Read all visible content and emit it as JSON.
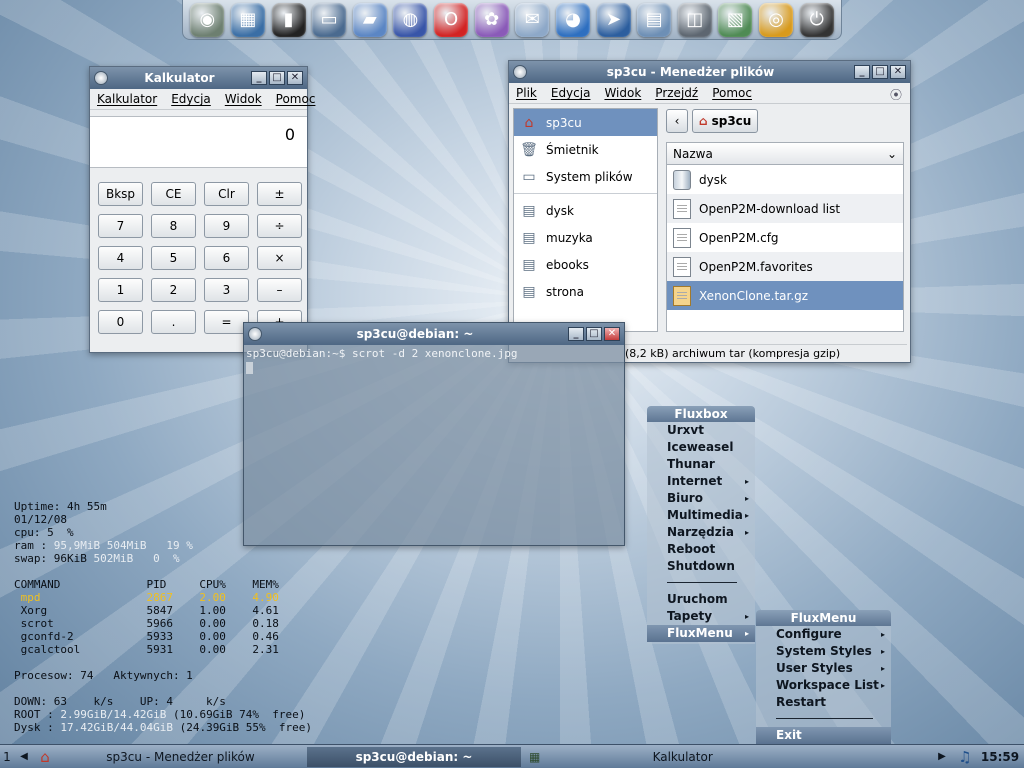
{
  "dock": {
    "icons": [
      {
        "name": "fluxbox-logo-icon",
        "glyph": "◉",
        "color": "#6d7f70"
      },
      {
        "name": "desktop-icon",
        "glyph": "▦",
        "color": "#3a6ea5"
      },
      {
        "name": "terminal-icon",
        "glyph": "▮",
        "color": "#222222"
      },
      {
        "name": "laptop-icon",
        "glyph": "▭",
        "color": "#4a6a8f"
      },
      {
        "name": "folder-icon",
        "glyph": "▰",
        "color": "#5b86c4"
      },
      {
        "name": "network-globe-icon",
        "glyph": "◍",
        "color": "#3855a8"
      },
      {
        "name": "opera-browser-icon",
        "glyph": "O",
        "color": "#d22323"
      },
      {
        "name": "pidgin-messenger-icon",
        "glyph": "✿",
        "color": "#8a5ab8"
      },
      {
        "name": "email-icon",
        "glyph": "✉",
        "color": "#8da8c8"
      },
      {
        "name": "web-browser-icon",
        "glyph": "◕",
        "color": "#2e6fc0"
      },
      {
        "name": "fish-icon",
        "glyph": "➤",
        "color": "#2c5e9e"
      },
      {
        "name": "office-document-icon",
        "glyph": "▤",
        "color": "#6d8fb5"
      },
      {
        "name": "speaker-icon",
        "glyph": "◫",
        "color": "#5d6670"
      },
      {
        "name": "image-viewer-icon",
        "glyph": "▧",
        "color": "#4f8b54"
      },
      {
        "name": "cd-burner-icon",
        "glyph": "◎",
        "color": "#d89a1c"
      },
      {
        "name": "power-icon",
        "glyph": "⏻",
        "color": "#333333"
      }
    ]
  },
  "calculator": {
    "title": "Kalkulator",
    "menu": [
      "Kalkulator",
      "Edycja",
      "Widok",
      "Pomoc"
    ],
    "display": "0",
    "buttons": [
      "Bksp",
      "CE",
      "Clr",
      "±",
      "7",
      "8",
      "9",
      "÷",
      "4",
      "5",
      "6",
      "×",
      "1",
      "2",
      "3",
      "–",
      "0",
      ".",
      "=",
      "+"
    ]
  },
  "filemanager": {
    "title": "sp3cu - Menedżer plików",
    "menu": [
      "Plik",
      "Edycja",
      "Widok",
      "Przejdź",
      "Pomoc"
    ],
    "sidebar": [
      {
        "label": "sp3cu",
        "icon": "home-icon",
        "selected": true
      },
      {
        "label": "Śmietnik",
        "icon": "trash-icon"
      },
      {
        "label": "System plików",
        "icon": "filesystem-icon"
      },
      {
        "label": "dysk",
        "icon": "drive-icon"
      },
      {
        "label": "muzyka",
        "icon": "drive-icon"
      },
      {
        "label": "ebooks",
        "icon": "drive-icon"
      },
      {
        "label": "strona",
        "icon": "drive-icon"
      }
    ],
    "path_button": "sp3cu",
    "column_header": "Nazwa",
    "files": [
      {
        "name": "dysk",
        "type": "drive"
      },
      {
        "name": "OpenP2M-download list",
        "type": "text"
      },
      {
        "name": "OpenP2M.cfg",
        "type": "text"
      },
      {
        "name": "OpenP2M.favorites",
        "type": "text"
      },
      {
        "name": "XenonClone.tar.gz",
        "type": "archive",
        "selected": true
      }
    ],
    "status": "(8,2 kB) archiwum tar (kompresja gzip)"
  },
  "terminal": {
    "title": "sp3cu@debian: ~",
    "line": "sp3cu@debian:~$ scrot -d 2 xenonclone.jpg"
  },
  "conky": {
    "uptime": "Uptime: 4h 55m",
    "date": "01/12/08",
    "cpu_label": "cpu: 5  %",
    "ram_label": "ram : ",
    "ram_used": "95,9MiB",
    "ram_rest": " 504MiB   19 %",
    "swap_label": "swap: 96KiB",
    "swap_rest": " 502MiB   0  %",
    "proc_header": "COMMAND             PID     CPU%    MEM%",
    "processes": [
      {
        "cmd": " mpd",
        "pid": "2867",
        "cpu": "2.00",
        "mem": "4.90",
        "highlight": true
      },
      {
        "cmd": " Xorg",
        "pid": "5847",
        "cpu": "1.00",
        "mem": "4.61"
      },
      {
        "cmd": " scrot",
        "pid": "5966",
        "cpu": "0.00",
        "mem": "0.18"
      },
      {
        "cmd": " gconfd-2",
        "pid": "5933",
        "cpu": "0.00",
        "mem": "0.46"
      },
      {
        "cmd": " gcalctool",
        "pid": "5931",
        "cpu": "0.00",
        "mem": "2.31"
      }
    ],
    "procs": "Procesow: 74   Aktywnych: 1",
    "net": "DOWN: 63    k/s    UP: 4     k/s",
    "root_label": "ROOT : ",
    "root_a": "2.99GiB",
    "root_b": "/14.42GiB",
    "root_c": " (10.69GiB 74%  free)",
    "dysk_label": "Dysk : ",
    "dysk_a": "17.42GiB",
    "dysk_b": "/44.04GiB",
    "dysk_c": " (24.39GiB 55%  free)"
  },
  "fluxbox_menu": {
    "title": "Fluxbox",
    "items_top": [
      {
        "label": "Urxvt"
      },
      {
        "label": "Iceweasel"
      },
      {
        "label": "Thunar"
      },
      {
        "label": "Internet",
        "sub": true
      },
      {
        "label": "Biuro",
        "sub": true
      },
      {
        "label": "Multimedia",
        "sub": true
      },
      {
        "label": "Narzędzia",
        "sub": true
      },
      {
        "label": "Reboot"
      },
      {
        "label": "Shutdown"
      }
    ],
    "items_bottom": [
      {
        "label": "Uruchom"
      },
      {
        "label": "Tapety",
        "sub": true
      },
      {
        "label": "FluxMenu",
        "sub": true,
        "active": true
      }
    ]
  },
  "fluxmenu": {
    "title": "FluxMenu",
    "items_top": [
      {
        "label": "Configure",
        "sub": true
      },
      {
        "label": "System Styles",
        "sub": true
      },
      {
        "label": "User Styles",
        "sub": true
      },
      {
        "label": "Workspace List",
        "sub": true
      },
      {
        "label": "Restart"
      }
    ],
    "items_bottom": [
      {
        "label": "Exit",
        "active": true
      }
    ]
  },
  "taskbar": {
    "workspace": "1",
    "prev": "◀",
    "tasks": [
      {
        "label": "sp3cu - Menedżer plików"
      },
      {
        "label": "sp3cu@debian: ~",
        "active": true
      },
      {
        "label": "Kalkulator"
      }
    ],
    "next": "▶",
    "clock": "15:59"
  }
}
